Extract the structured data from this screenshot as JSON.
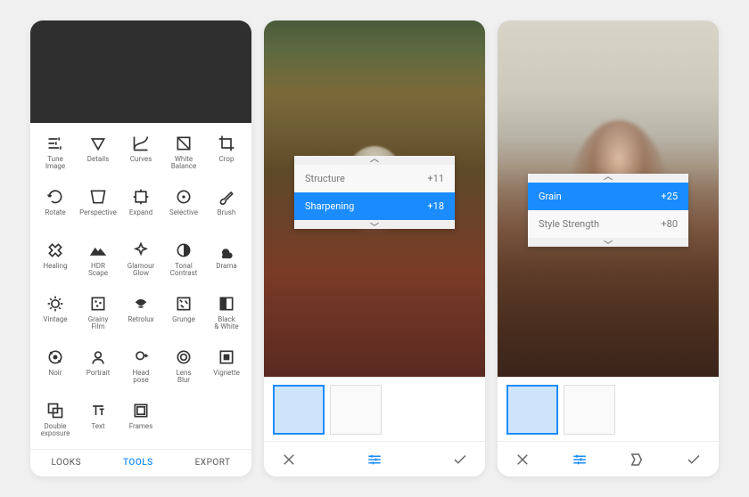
{
  "screen1": {
    "tools": [
      {
        "label": "Tune Image",
        "icon": "sliders"
      },
      {
        "label": "Details",
        "icon": "triangle-down"
      },
      {
        "label": "Curves",
        "icon": "curve"
      },
      {
        "label": "White Balance",
        "icon": "wb"
      },
      {
        "label": "Crop",
        "icon": "crop"
      },
      {
        "label": "Rotate",
        "icon": "rotate"
      },
      {
        "label": "Perspective",
        "icon": "perspective"
      },
      {
        "label": "Expand",
        "icon": "expand"
      },
      {
        "label": "Selective",
        "icon": "selective"
      },
      {
        "label": "Brush",
        "icon": "brush"
      },
      {
        "label": "Healing",
        "icon": "healing"
      },
      {
        "label": "HDR Scape",
        "icon": "hdr"
      },
      {
        "label": "Glamour Glow",
        "icon": "glow"
      },
      {
        "label": "Tonal Contrast",
        "icon": "tonal"
      },
      {
        "label": "Drama",
        "icon": "drama"
      },
      {
        "label": "Vintage",
        "icon": "vintage"
      },
      {
        "label": "Grainy Film",
        "icon": "grainy"
      },
      {
        "label": "Retrolux",
        "icon": "retrolux"
      },
      {
        "label": "Grunge",
        "icon": "grunge"
      },
      {
        "label": "Black & White",
        "icon": "bw"
      },
      {
        "label": "Noir",
        "icon": "noir"
      },
      {
        "label": "Portrait",
        "icon": "portrait"
      },
      {
        "label": "Head pose",
        "icon": "head"
      },
      {
        "label": "Lens Blur",
        "icon": "lensblur"
      },
      {
        "label": "Vignette",
        "icon": "vignette"
      },
      {
        "label": "Double exposure",
        "icon": "double"
      },
      {
        "label": "Text",
        "icon": "text"
      },
      {
        "label": "Frames",
        "icon": "frames"
      }
    ],
    "nav": {
      "looks": "LOOKS",
      "tools": "TOOLS",
      "export": "EXPORT"
    }
  },
  "screen2": {
    "adjust": [
      {
        "label": "Structure",
        "value": "+11",
        "selected": false
      },
      {
        "label": "Sharpening",
        "value": "+18",
        "selected": true
      }
    ]
  },
  "screen3": {
    "adjust": [
      {
        "label": "Grain",
        "value": "+25",
        "selected": true
      },
      {
        "label": "Style Strength",
        "value": "+80",
        "selected": false
      }
    ]
  }
}
